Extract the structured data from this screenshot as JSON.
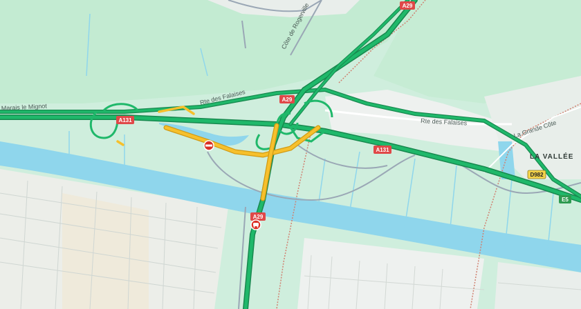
{
  "map": {
    "place_labels": {
      "marais": "Marais le Mignot",
      "rte_falaises_west": "Rte des Falaises",
      "rte_falaises_east": "Rte des Falaises",
      "cote_rogerville": "Côte de Rogerville",
      "grande_cote": "La Grande Côte",
      "la_vallee": "LA VALLÉE"
    },
    "road_shields": {
      "a29_top": "A29",
      "a29_mid": "A29",
      "a29_south": "A29",
      "a131_west": "A131",
      "a131_east": "A131",
      "d982": "D982",
      "e5": "E5"
    },
    "colors": {
      "land": "#cfeedd",
      "green_area": "#bfe8cc",
      "urban": "#eef1ef",
      "water": "#8fd6ec",
      "highway_free_flow": "#1fb86a",
      "highway_slow": "#f6c02c",
      "incident_red": "#d93025",
      "shield_red": "#e04848",
      "shield_yellow": "#f5d34a"
    },
    "icons": {
      "road_closed": "road-closed-icon",
      "incident": "incident-icon"
    }
  }
}
